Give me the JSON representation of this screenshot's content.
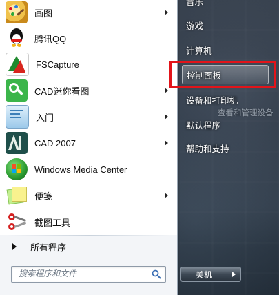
{
  "start_menu": {
    "programs": [
      {
        "label": "画图",
        "icon": "paint-icon",
        "has_submenu": true
      },
      {
        "label": "腾讯QQ",
        "icon": "qq-penguin-icon",
        "has_submenu": false
      },
      {
        "label": "FSCapture",
        "icon": "fscapture-icon",
        "has_submenu": false
      },
      {
        "label": "CAD迷你看图",
        "icon": "cad-mini-viewer-icon",
        "has_submenu": true
      },
      {
        "label": "入门",
        "icon": "getting-started-icon",
        "has_submenu": true
      },
      {
        "label": "CAD 2007",
        "icon": "autocad-icon",
        "has_submenu": true
      },
      {
        "label": "Windows Media Center",
        "icon": "windows-media-center-icon",
        "has_submenu": false
      },
      {
        "label": "便笺",
        "icon": "sticky-notes-icon",
        "has_submenu": true
      },
      {
        "label": "截图工具",
        "icon": "snipping-tool-icon",
        "has_submenu": false
      }
    ],
    "all_programs_label": "所有程序",
    "search": {
      "placeholder": "搜索程序和文件"
    }
  },
  "right_pane": {
    "top_cut_label": "音乐",
    "items": [
      {
        "label": "游戏"
      },
      {
        "label": "计算机"
      },
      {
        "label": "控制面板",
        "highlighted": true
      },
      {
        "label": "设备和打印机"
      },
      {
        "label": "默认程序"
      },
      {
        "label": "帮助和支持"
      }
    ],
    "tooltip_hint": "查看和管理设备"
  },
  "shutdown": {
    "label": "关机"
  },
  "colors": {
    "annotation_red": "#e2141a",
    "pane_white": "#ffffff"
  }
}
